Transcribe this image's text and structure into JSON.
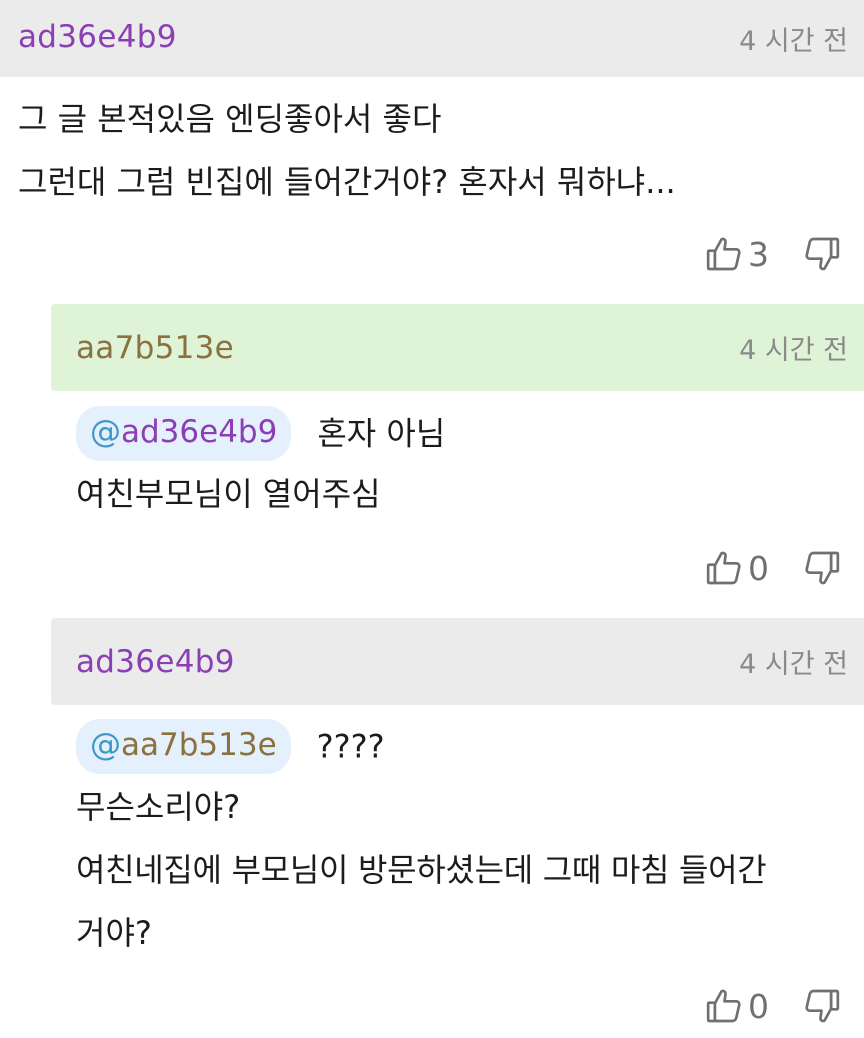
{
  "colors": {
    "purple_user": "#8b3fb5",
    "olive_user": "#8a7140",
    "mention_blue": "#3e97c8",
    "reply_highlight": "#dff3d7",
    "header_gray": "#ebebeb"
  },
  "icons": [
    "thumbs-up-icon",
    "thumbs-down-icon"
  ],
  "comment": {
    "username": "ad36e4b9",
    "time": "4 시간 전",
    "lines": [
      "그 글 본적있음 엔딩좋아서 좋다",
      "그런대 그럼 빈집에 들어간거야? 혼자서 뭐하냐..."
    ],
    "likes": "3"
  },
  "replies": [
    {
      "username": "aa7b513e",
      "time": "4 시간 전",
      "mention": "@ad36e4b9",
      "mention_user": "ad36e4b9",
      "first_text": "혼자 아님",
      "lines": [
        "여친부모님이 열어주심"
      ],
      "likes": "0"
    },
    {
      "username": "ad36e4b9",
      "time": "4 시간 전",
      "mention": "@aa7b513e",
      "mention_user": "aa7b513e",
      "first_text": "????",
      "lines": [
        "무슨소리야?",
        "여친네집에 부모님이 방문하셨는데 그때 마침 들어간",
        "거야?"
      ],
      "likes": "0"
    }
  ]
}
